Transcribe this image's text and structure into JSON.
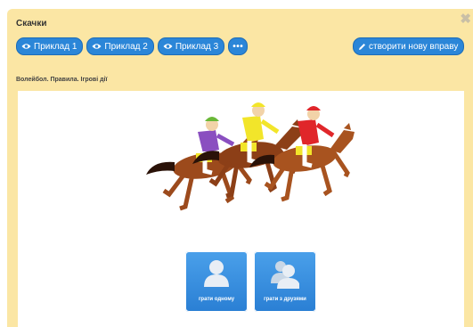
{
  "dialog": {
    "title": "Скачки",
    "close_symbol": "✖"
  },
  "toolbar": {
    "example_1": "Приклад 1",
    "example_2": "Приклад 2",
    "example_3": "Приклад 3",
    "more": "•••",
    "create": "створити нову вправу"
  },
  "subtitle": "Волейбол. Правила. Ігрові дії",
  "modes": {
    "single": "грати одному",
    "friends": "грати з друзями"
  },
  "icons": {
    "example": "eye-icon",
    "create": "pencil-icon",
    "single": "user-icon",
    "friends": "users-icon",
    "close": "close-icon"
  },
  "colors": {
    "dialog_bg": "#fbe6a4",
    "button_blue": "#2b86d8",
    "jockey_purple": "#8a4fc0",
    "jockey_yellow": "#f2e52a",
    "jockey_red": "#e0262a",
    "horse_brown": "#9c4a1c"
  }
}
